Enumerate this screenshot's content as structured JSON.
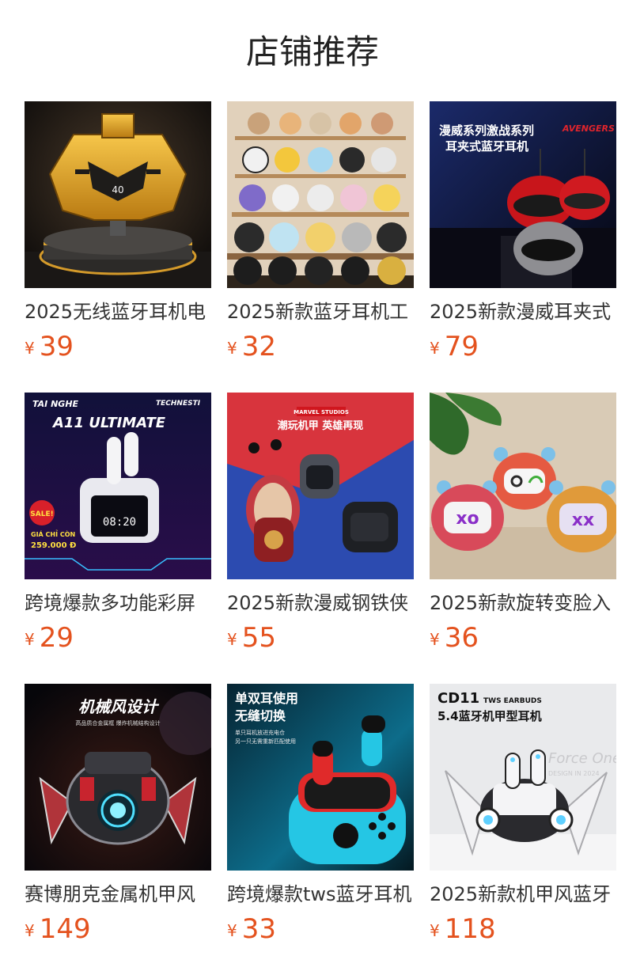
{
  "section": {
    "title": "店铺推荐"
  },
  "currency_symbol": "¥",
  "colors": {
    "price": "#e4521e",
    "title": "#222222",
    "product_name": "#333333"
  },
  "products": [
    {
      "name": "2025无线蓝牙耳机电",
      "price": "39",
      "image_icon": "mecha-earbud-case-image",
      "image_text": []
    },
    {
      "name": "2025新款蓝牙耳机工",
      "price": "32",
      "image_icon": "cartoon-earbud-shelf-image",
      "image_text": []
    },
    {
      "name": "2025新款漫威耳夹式",
      "price": "79",
      "image_icon": "marvel-helmet-earbuds-image",
      "image_text": [
        "漫威系列激战系列",
        "耳夹式蓝牙耳机",
        "AVENGERS"
      ]
    },
    {
      "name": "跨境爆款多功能彩屏",
      "price": "29",
      "image_icon": "screen-earbuds-case-image",
      "image_text": [
        "TAI NGHE",
        "TECHNESTI",
        "A11 ULTIMATE",
        "SALE!",
        "GIÁ CHỈ CÒN",
        "259.000 Đ",
        "08:20"
      ]
    },
    {
      "name": "2025新款漫威钢铁侠",
      "price": "55",
      "image_icon": "marvel-cube-earbuds-image",
      "image_text": [
        "MARVEL STUDIOS",
        "潮玩机甲 英雄再现"
      ]
    },
    {
      "name": "2025新款旋转变脸入",
      "price": "36",
      "image_icon": "graffiti-face-earbuds-image",
      "image_text": []
    },
    {
      "name": "赛博朋克金属机甲风",
      "price": "149",
      "image_icon": "cyber-mecha-earbuds-image",
      "image_text": [
        "机械风设计",
        "高品质合金属框 爆炸机械结构设计"
      ]
    },
    {
      "name": "跨境爆款tws蓝牙耳机",
      "price": "33",
      "image_icon": "gamepad-earbuds-image",
      "image_text": [
        "单双耳使用",
        "无缝切换",
        "单只耳机放进充电仓",
        "另一只无需重新匹配使用"
      ]
    },
    {
      "name": "2025新款机甲风蓝牙",
      "price": "118",
      "image_icon": "white-mecha-earbuds-image",
      "image_text": [
        "CD11",
        "TWS EARBUDS",
        "5.4蓝牙机甲型耳机",
        "Force One",
        "DESIGN IN 2024"
      ]
    }
  ]
}
